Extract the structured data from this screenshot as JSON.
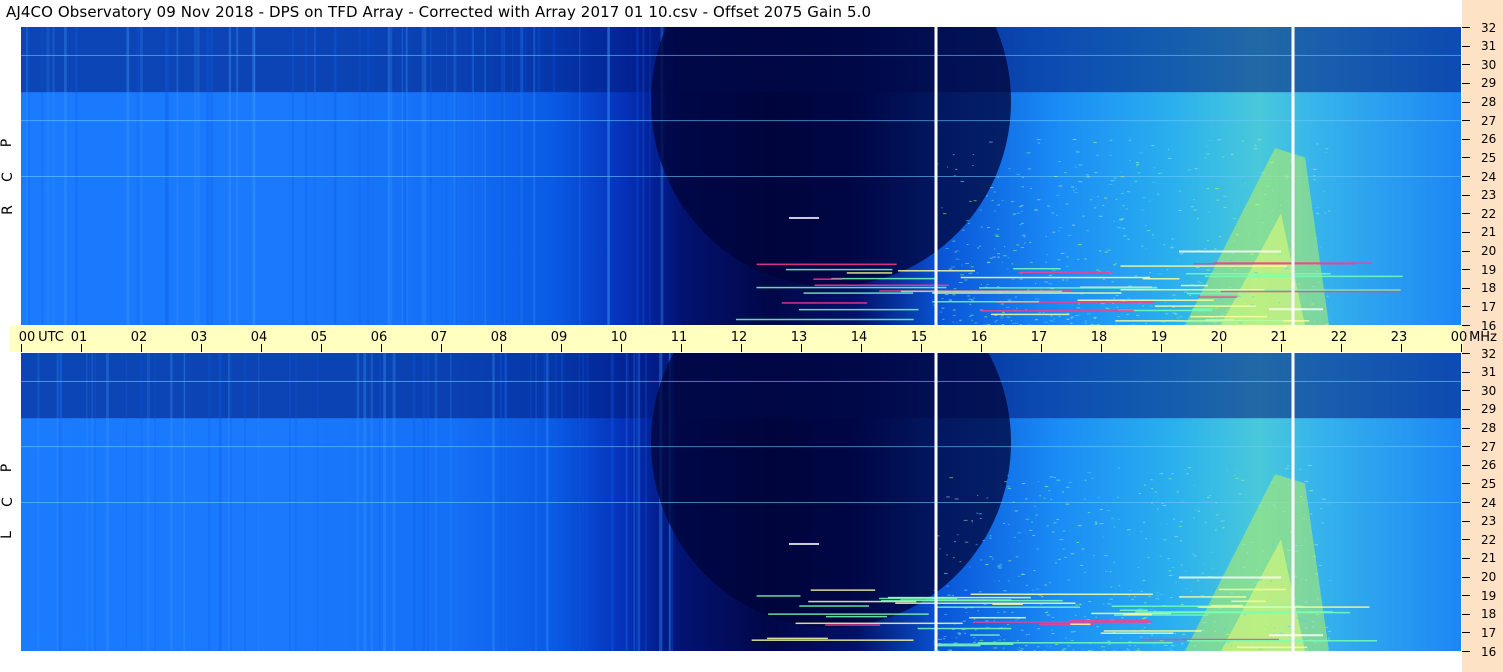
{
  "title": "AJ4CO Observatory  09 Nov 2018  -  DPS on TFD Array  -  Corrected with Array 2017 01 10.csv  -  Offset 2075  Gain 5.0",
  "chart_data": [
    {
      "type": "heatmap",
      "panel": "RCP",
      "polarization_label": [
        "R",
        "C",
        "P"
      ],
      "x_axis": {
        "unit_label": "UTC",
        "range": [
          0,
          24
        ],
        "tick_labels": [
          "00",
          "01",
          "02",
          "03",
          "04",
          "05",
          "06",
          "07",
          "08",
          "09",
          "10",
          "11",
          "12",
          "13",
          "14",
          "15",
          "16",
          "17",
          "18",
          "19",
          "20",
          "21",
          "22",
          "23",
          "00"
        ]
      },
      "y_axis": {
        "unit_label": "MHz",
        "range": [
          16,
          32
        ],
        "tick_labels": [
          "32",
          "31",
          "30",
          "29",
          "28",
          "27",
          "26",
          "25",
          "24",
          "23",
          "22",
          "21",
          "20",
          "19",
          "18",
          "17",
          "16"
        ]
      },
      "data_gaps_utc": [
        15.25,
        21.2
      ],
      "description_features": {
        "quiet_background_utc": [
          0,
          10.5
        ],
        "low_power_utc": [
          11,
          15.5
        ],
        "enhanced_emission_utc": [
          19.5,
          21.5
        ],
        "persistent_freq_lines_mhz": [
          27,
          24,
          30.5
        ]
      }
    },
    {
      "type": "heatmap",
      "panel": "LCP",
      "polarization_label": [
        "L",
        "C",
        "P"
      ],
      "x_axis": {
        "unit_label": "UTC",
        "range": [
          0,
          24
        ]
      },
      "y_axis": {
        "unit_label": "MHz",
        "range": [
          16,
          32
        ],
        "tick_labels": [
          "32",
          "31",
          "30",
          "29",
          "28",
          "27",
          "26",
          "25",
          "24",
          "23",
          "22",
          "21",
          "20",
          "19",
          "18",
          "17",
          "16"
        ]
      },
      "data_gaps_utc": [
        15.25,
        21.2
      ]
    }
  ],
  "time_axis": {
    "utc_label": "UTC",
    "mhz_label": "MHz",
    "labels": [
      "00",
      "01",
      "02",
      "03",
      "04",
      "05",
      "06",
      "07",
      "08",
      "09",
      "10",
      "11",
      "12",
      "13",
      "14",
      "15",
      "16",
      "17",
      "18",
      "19",
      "20",
      "21",
      "22",
      "23",
      "00"
    ]
  },
  "freq_axis": {
    "labels": [
      "32",
      "31",
      "30",
      "29",
      "28",
      "27",
      "26",
      "25",
      "24",
      "23",
      "22",
      "21",
      "20",
      "19",
      "18",
      "17",
      "16"
    ]
  },
  "colors": {
    "background": "#ffffff",
    "time_bar": "#ffffc0",
    "right_strip": "#fde2c5",
    "spectrum_low": "#010747",
    "spectrum_mid": "#1a7bff",
    "spectrum_high": "#49c9da",
    "hot": "#ff3a8c"
  }
}
